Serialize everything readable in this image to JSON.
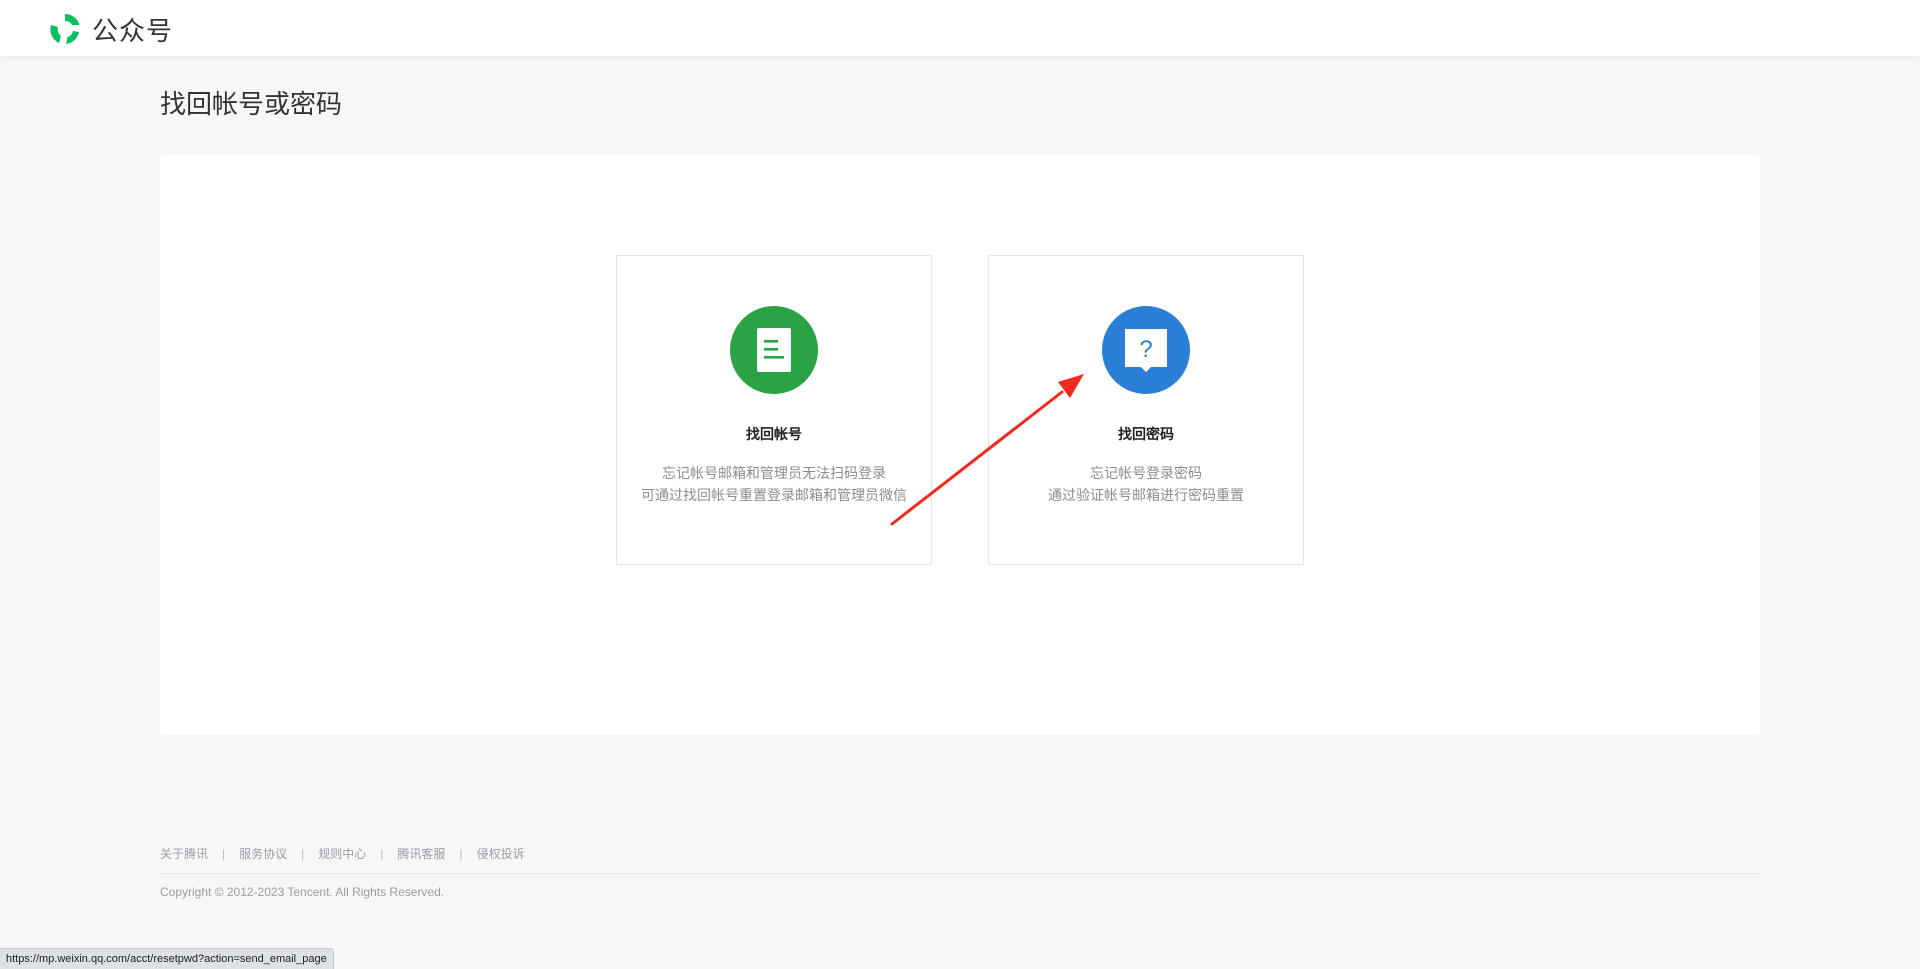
{
  "header": {
    "brand_name": "公众号",
    "logo_icon": "weixin-mp-logo-icon",
    "logo_color": "#07c160"
  },
  "page": {
    "title": "找回帐号或密码"
  },
  "cards": [
    {
      "title": "找回帐号",
      "desc_lines": [
        "忘记帐号邮箱和管理员无法扫码登录",
        "可通过找回帐号重置登录邮箱和管理员微信"
      ],
      "icon": "document-icon",
      "icon_color": "#2aa344"
    },
    {
      "title": "找回密码",
      "desc_lines": [
        "忘记帐号登录密码",
        "通过验证帐号邮箱进行密码重置"
      ],
      "icon": "question-bubble-icon",
      "icon_color": "#2b7fd6"
    }
  ],
  "annotation": {
    "arrow_color": "#f02a1e"
  },
  "footer": {
    "links": [
      "关于腾讯",
      "服务协议",
      "规则中心",
      "腾讯客服",
      "侵权投诉"
    ],
    "separator": "|",
    "copyright": "Copyright © 2012-2023 Tencent. All Rights Reserved."
  },
  "status_bar": {
    "url": "https://mp.weixin.qq.com/acct/resetpwd?action=send_email_page"
  }
}
